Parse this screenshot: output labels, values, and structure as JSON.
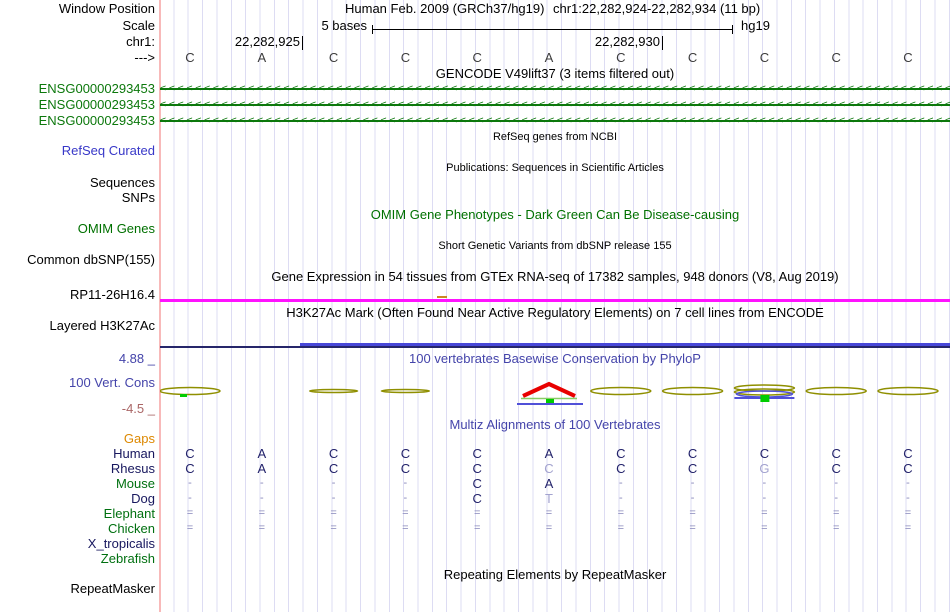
{
  "header": {
    "window_position_label": "Window Position",
    "assembly": "Human Feb. 2009 (GRCh37/hg19)",
    "position": "chr1:22,282,924-22,282,934 (11 bp)",
    "scale_label": "Scale",
    "scale_value": "5 bases",
    "genome": "hg19",
    "chrom_label": "chr1:",
    "ruler_ticks": [
      "22,282,925",
      "22,282,930"
    ],
    "strand_arrow": "--->",
    "sequence": [
      "C",
      "A",
      "C",
      "C",
      "C",
      "A",
      "C",
      "C",
      "C",
      "C",
      "C"
    ]
  },
  "tracks": {
    "gencode": {
      "title": "GENCODE V49lift37 (3 items filtered out)",
      "genes": [
        "ENSG00000293453",
        "ENSG00000293453",
        "ENSG00000293453"
      ]
    },
    "refseq": {
      "title": "RefSeq genes from NCBI",
      "label": "RefSeq Curated"
    },
    "publications": {
      "title": "Publications: Sequences in Scientific Articles",
      "label_sequences": "Sequences",
      "label_snps": "SNPs"
    },
    "omim": {
      "title": "OMIM Gene Phenotypes - Dark Green Can Be Disease-causing",
      "label": "OMIM Genes"
    },
    "dbsnp": {
      "title": "Short Genetic Variants from dbSNP release 155",
      "label": "Common dbSNP(155)"
    },
    "gtex": {
      "title": "Gene Expression in 54 tissues from GTEx RNA-seq of 17382 samples, 948 donors (V8, Aug 2019)",
      "label": "RP11-26H16.4"
    },
    "h3k27ac": {
      "title": "H3K27Ac Mark (Often Found Near Active Regulatory Elements) on 7 cell lines from ENCODE",
      "label": "Layered H3K27Ac"
    },
    "phylop": {
      "title": "100 vertebrates Basewise Conservation by PhyloP",
      "label": "100 Vert. Cons",
      "max_label": "4.88 _",
      "min_label": "-4.5 _",
      "features": [
        {
          "base": 1,
          "shape": "ellipse-green"
        },
        {
          "base": 3,
          "shape": "flat"
        },
        {
          "base": 4,
          "shape": "flat"
        },
        {
          "base": 6,
          "shape": "peak"
        },
        {
          "base": 7,
          "shape": "ellipse"
        },
        {
          "base": 8,
          "shape": "ellipse"
        },
        {
          "base": 9,
          "shape": "complex"
        },
        {
          "base": 10,
          "shape": "ellipse"
        },
        {
          "base": 11,
          "shape": "ellipse"
        }
      ]
    },
    "multiz": {
      "title": "Multiz Alignments of 100 Vertebrates",
      "gaps_label": "Gaps",
      "species": [
        {
          "name": "Human",
          "color": "navy",
          "cells": [
            "C",
            "A",
            "C",
            "C",
            "C",
            "A",
            "C",
            "C",
            "C",
            "C",
            "C"
          ],
          "light": []
        },
        {
          "name": "Rhesus",
          "color": "navy",
          "cells": [
            "C",
            "A",
            "C",
            "C",
            "C",
            "C",
            "C",
            "C",
            "G",
            "C",
            "C"
          ],
          "light": [
            5,
            8
          ]
        },
        {
          "name": "Mouse",
          "color": "green",
          "cells": [
            "-",
            "-",
            "-",
            "-",
            "C",
            "A",
            "-",
            "-",
            "-",
            "-",
            "-"
          ],
          "light": []
        },
        {
          "name": "Dog",
          "color": "navy",
          "cells": [
            "-",
            "-",
            "-",
            "-",
            "C",
            "T",
            "-",
            "-",
            "-",
            "-",
            "-"
          ],
          "light": [
            5
          ]
        },
        {
          "name": "Elephant",
          "color": "green",
          "cells": [
            "=",
            "=",
            "=",
            "=",
            "=",
            "=",
            "=",
            "=",
            "=",
            "=",
            "="
          ],
          "light": []
        },
        {
          "name": "Chicken",
          "color": "green",
          "cells": [
            "=",
            "=",
            "=",
            "=",
            "=",
            "=",
            "=",
            "=",
            "=",
            "=",
            "="
          ],
          "light": []
        },
        {
          "name": "X_tropicalis",
          "color": "navy",
          "cells": [
            "",
            "",
            "",
            "",
            "",
            "",
            "",
            "",
            "",
            "",
            ""
          ],
          "light": []
        },
        {
          "name": "Zebrafish",
          "color": "green",
          "cells": [
            "",
            "",
            "",
            "",
            "",
            "",
            "",
            "",
            "",
            "",
            ""
          ],
          "light": []
        }
      ]
    },
    "repeatmasker": {
      "title": "Repeating Elements by RepeatMasker",
      "label": "RepeatMasker"
    }
  },
  "colors": {
    "gene_green": "#0c780c",
    "track_blue": "#3838c8",
    "omim_green": "#007000",
    "phylop_blue": "#4444aa",
    "phylop_min_red": "#aa6666",
    "gaps_orange": "#dd8800",
    "species_navy": "#17175e",
    "species_green": "#007010",
    "align_dark": "#22226a",
    "align_light": "#a3a3cf",
    "align_gap": "#8888bb",
    "gtex_magenta": "#ff12ff",
    "h3k27ac_navy": "#26266a",
    "h3k27ac_blue": "#4848d8",
    "conservation_olive": "#8f8f00",
    "conservation_red": "#e80000",
    "conservation_green": "#00cc00",
    "conservation_blue": "#5050d8",
    "gridline": "#dddcf3",
    "divider_pink": "#f8b9b9"
  }
}
